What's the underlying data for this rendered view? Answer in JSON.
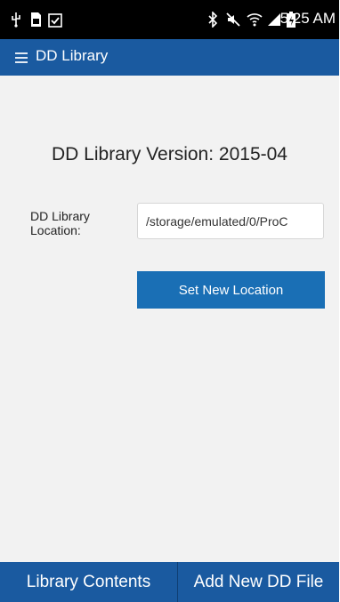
{
  "status_bar": {
    "time": "5:25 AM",
    "icons": [
      "usb-icon",
      "sd-card-icon",
      "clipboard-check-icon",
      "bluetooth-icon",
      "mute-icon",
      "wifi-icon",
      "signal-icon",
      "battery-charging-icon"
    ]
  },
  "app_bar": {
    "title": "DD Library",
    "menu_icon": "hamburger-menu-icon"
  },
  "main": {
    "version_text": "DD Library Version: 2015-04",
    "location_label": "DD Library\nLocation:",
    "location_value": "/storage/emulated/0/ProC",
    "set_button_label": "Set New Location"
  },
  "bottom_bar": {
    "tabs": [
      {
        "label": "Library Contents"
      },
      {
        "label": "Add New DD File"
      }
    ]
  },
  "colors": {
    "primary": "#1a5aa0",
    "button": "#1a6fb5",
    "background": "#f2f2f2",
    "statusbar": "#000000"
  }
}
